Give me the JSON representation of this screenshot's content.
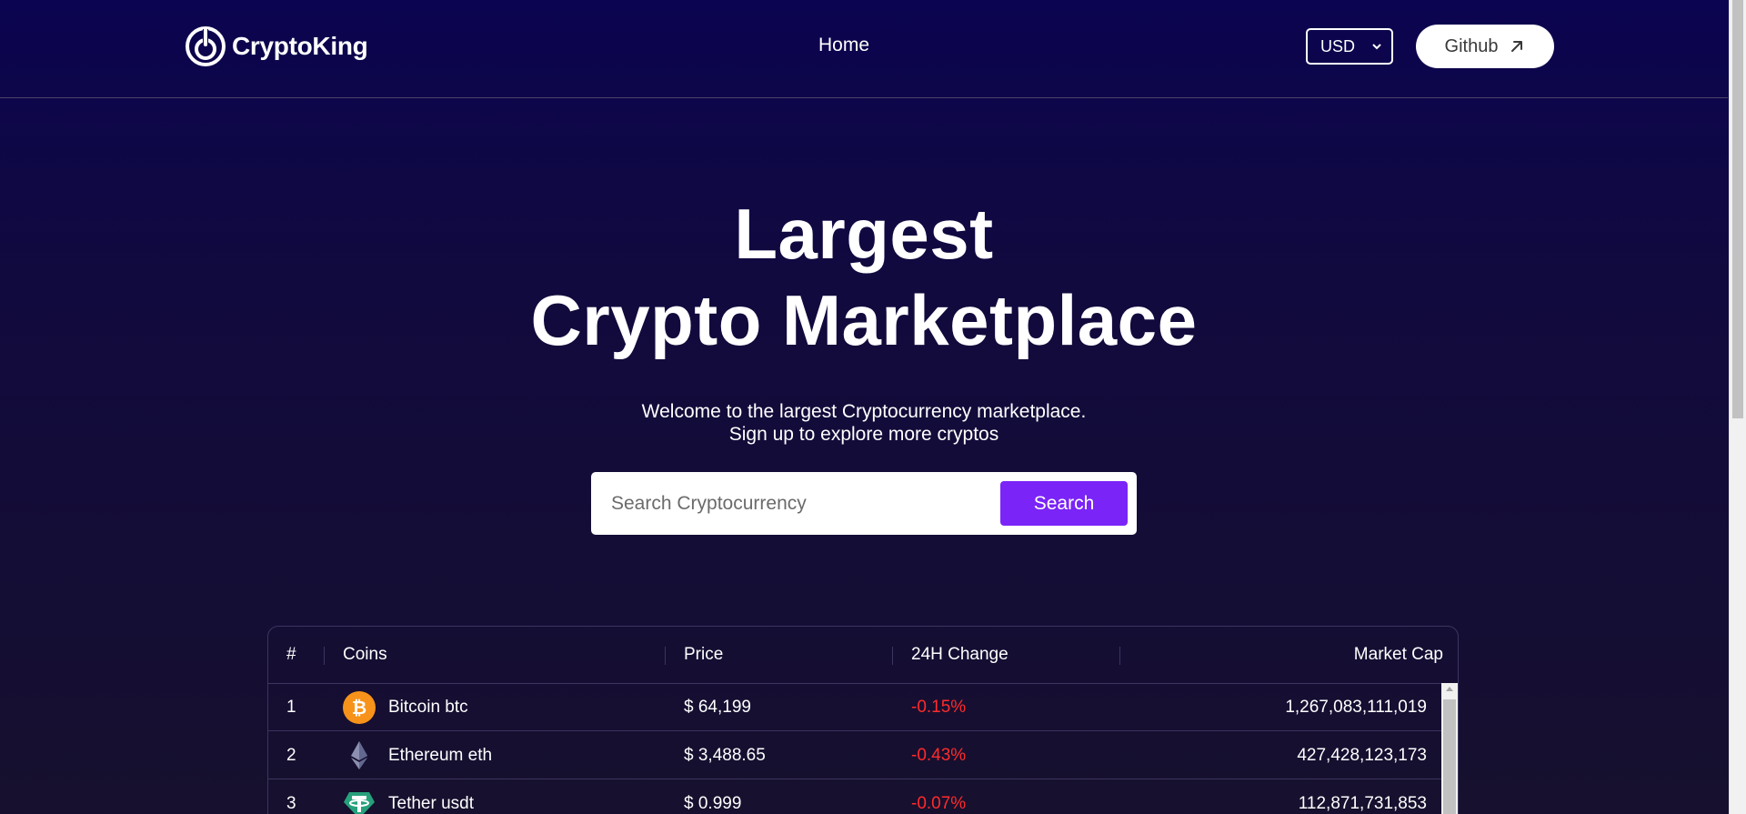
{
  "navbar": {
    "logo_text": "CryptoKing",
    "links": [
      "Home"
    ],
    "currency": "USD",
    "github_label": "Github"
  },
  "hero": {
    "title_line1": "Largest",
    "title_line2": "Crypto Marketplace",
    "subtitle_line1": "Welcome to the largest Cryptocurrency marketplace.",
    "subtitle_line2": "Sign up to explore more cryptos"
  },
  "search": {
    "placeholder": "Search Cryptocurrency",
    "button_label": "Search"
  },
  "table": {
    "headers": {
      "rank": "#",
      "coins": "Coins",
      "price": "Price",
      "change": "24H Change",
      "market_cap": "Market Cap"
    },
    "rows": [
      {
        "rank": "1",
        "name": "Bitcoin btc",
        "price": "$ 64,199",
        "change": "-0.15%",
        "market_cap": "1,267,083,111,019",
        "icon": "bitcoin-icon"
      },
      {
        "rank": "2",
        "name": "Ethereum eth",
        "price": "$ 3,488.65",
        "change": "-0.43%",
        "market_cap": "427,428,123,173",
        "icon": "ethereum-icon"
      },
      {
        "rank": "3",
        "name": "Tether usdt",
        "price": "$ 0.999",
        "change": "-0.07%",
        "market_cap": "112,871,731,853",
        "icon": "tether-icon"
      }
    ]
  },
  "colors": {
    "background_top": "#0b0450",
    "background_bottom": "#17102e",
    "accent": "#7a24f7",
    "negative": "#ff2b2b"
  }
}
